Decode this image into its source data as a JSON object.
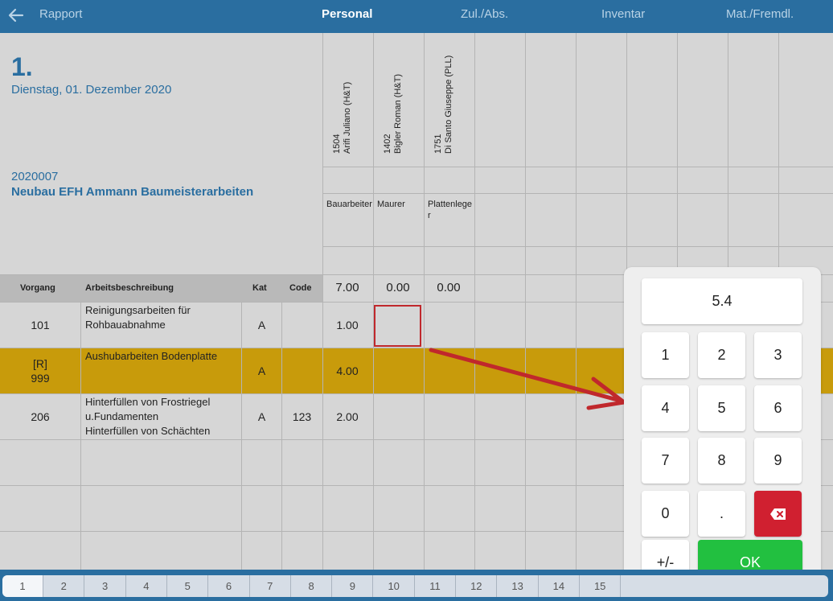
{
  "nav": {
    "back_label": "Rapport",
    "tabs": [
      {
        "label": "Personal",
        "active": true
      },
      {
        "label": "Zul./Abs.",
        "active": false
      },
      {
        "label": "Inventar",
        "active": false
      },
      {
        "label": "Mat./Fremdl.",
        "active": false
      }
    ]
  },
  "report": {
    "number": "1.",
    "date": "Dienstag, 01. Dezember 2020",
    "project_number": "2020007",
    "project_name": "Neubau EFH Ammann Baumeisterarbeiten"
  },
  "employees": [
    {
      "name": "1504\nArifi Juliano (H&T)",
      "role": "Bauarbeiter",
      "total": "7.00"
    },
    {
      "name": "1402\nBigler Roman (H&T)",
      "role": "Maurer",
      "total": "0.00"
    },
    {
      "name": "1751\nDi Santo Giuseppe (PLL)",
      "role": "Plattenleger",
      "total": "0.00"
    }
  ],
  "columns": {
    "vorgang": "Vorgang",
    "beschreibung": "Arbeitsbeschreibung",
    "kat": "Kat",
    "code": "Code"
  },
  "rows": [
    {
      "vorgang": "101",
      "beschreibung": "Reinigungsarbeiten für\nRohbauabnahme",
      "kat": "A",
      "code": "",
      "hours": "1.00",
      "highlight": false
    },
    {
      "vorgang": "[R]\n999",
      "beschreibung": "Aushubarbeiten Bodenplatte",
      "kat": "A",
      "code": "",
      "hours": "4.00",
      "highlight": true
    },
    {
      "vorgang": "206",
      "beschreibung": "Hinterfüllen von Frostriegel\nu.Fundamenten\nHinterfüllen von Schächten",
      "kat": "A",
      "code": "123",
      "hours": "2.00",
      "highlight": false
    }
  ],
  "keypad": {
    "display": "5.4",
    "keys": [
      "1",
      "2",
      "3",
      "4",
      "5",
      "6",
      "7",
      "8",
      "9",
      "0",
      "."
    ],
    "sign_label": "+/-",
    "ok_label": "OK",
    "delete_icon": "backspace-icon"
  },
  "pages": [
    "1",
    "2",
    "3",
    "4",
    "5",
    "6",
    "7",
    "8",
    "9",
    "10",
    "11",
    "12",
    "13",
    "14",
    "15"
  ],
  "colors": {
    "primary": "#2a6ea0",
    "highlight_row": "#c89b0b",
    "ok": "#22c040",
    "delete": "#d02030",
    "annotation": "#c0282c"
  }
}
